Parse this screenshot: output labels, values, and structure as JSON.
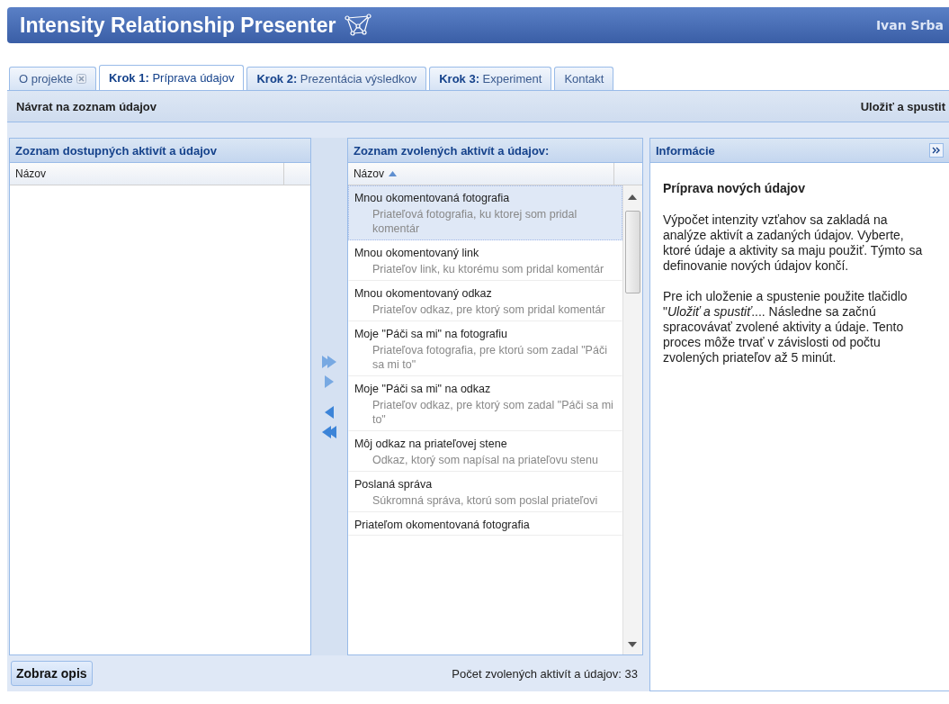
{
  "header": {
    "title": "Intensity Relationship Presenter",
    "user": "Ivan Srba"
  },
  "tabs": [
    {
      "label": "O projekte",
      "closable": true,
      "selected": false
    },
    {
      "label": "**Krok 1:** Príprava údajov",
      "closable": false,
      "selected": true
    },
    {
      "label": "**Krok 2:** Prezentácia výsledkov",
      "closable": false,
      "selected": false
    },
    {
      "label": "**Krok 3:** Experiment",
      "closable": false,
      "selected": false
    },
    {
      "label": "Kontakt",
      "closable": false,
      "selected": false
    }
  ],
  "toolbar": {
    "back": "Návrat na zoznam údajov",
    "save": "Uložiť a spustit"
  },
  "available_panel": {
    "title": "Zoznam dostupných aktivít a údajov",
    "column": "Názov"
  },
  "selected_panel": {
    "title": "Zoznam zvolených aktivít a údajov:",
    "column": "Názov",
    "rows": [
      {
        "title": "Mnou okomentovaná fotografia",
        "description": "Priateľová fotografia, ku ktorej som pridal komentár",
        "selected": true
      },
      {
        "title": "Mnou okomentovaný link",
        "description": "Priateľov link, ku ktorému som pridal komentár",
        "selected": false
      },
      {
        "title": "Mnou okomentovaný odkaz",
        "description": "Priateľov odkaz, pre ktorý som pridal komentár",
        "selected": false
      },
      {
        "title": "Moje \"Páči sa mi\" na fotografiu",
        "description": "Priateľova fotografia, pre ktorú som zadal \"Páči sa mi to\"",
        "selected": false
      },
      {
        "title": "Moje \"Páči sa mi\" na odkaz",
        "description": "Priateľov odkaz, pre ktorý som zadal \"Páči sa mi to\"",
        "selected": false
      },
      {
        "title": "Môj odkaz na priateľovej stene",
        "description": "Odkaz, ktorý som napísal na priateľovu stenu",
        "selected": false
      },
      {
        "title": "Poslaná správa",
        "description": "Súkromná správa, ktorú som poslal priateľovi",
        "selected": false
      },
      {
        "title": "Priateľom okomentovaná fotografia",
        "selected": false
      }
    ]
  },
  "bottom_bar": {
    "button": "Zobraz opis",
    "count": "Počet zvolených aktivít a údajov: 33"
  },
  "info_panel": {
    "title": "Informácie",
    "heading": "Príprava nových údajov",
    "paragraphs": [
      "Výpočet intenzity vzťahov sa zakladá na analýze aktivít a zadaných údajov. Vyberte, ktoré údaje a aktivity sa maju použiť. Týmto sa definovanie nových údajov končí.",
      "Pre ich uloženie a spustenie použite tlačidlo \"*Uložiť a spustiť*.... Následne sa začnú spracovávať zvolené aktivity a údaje. Tento proces môže trvať v závislosti od počtu zvolených priateľov až 5 minút."
    ]
  }
}
